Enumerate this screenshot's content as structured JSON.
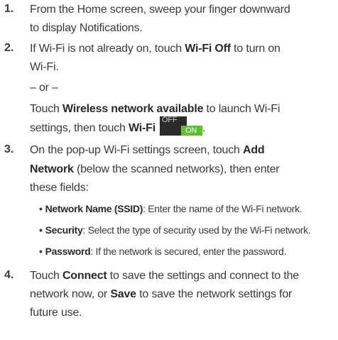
{
  "steps": [
    {
      "number": "1.",
      "text1": "From the Home screen, sweep your finger downward",
      "text2": "to display Notifications."
    },
    {
      "number": "2.",
      "pre": "If Wi-Fi is not already on, touch ",
      "bold": "Wi-Fi Off",
      "post": " to turn on",
      "cont": "Wi-Fi.",
      "or": "– or –",
      "alt_pre": "Touch ",
      "alt_bold": "Wireless network available",
      "alt_post": " to launch Wi-Fi",
      "alt2_pre": "settings, then touch ",
      "alt2_bold": "Wi-Fi",
      "alt2_post": ".",
      "toggle": {
        "off": "OFF",
        "on": "ON",
        "on_color": "#5cc22b"
      }
    },
    {
      "number": "3.",
      "pre": "On the pop-up Wi-Fi settings screen, touch ",
      "bold": "Add",
      "line2_bold": "Network",
      "line2_post": " (below the scanned networks), then enter",
      "line3": "these fields:",
      "fields": [
        {
          "name": "Network Name (SSID)",
          "desc": ": Enter the name of the Wi-Fi network."
        },
        {
          "name": "Security",
          "desc": ": Select the type of security used by the Wi-Fi network."
        },
        {
          "name": "Password",
          "desc": ": If the network is secured, enter the password."
        }
      ]
    },
    {
      "number": "4.",
      "pre": "Touch ",
      "bold": "Connect",
      "post": " to save the settings and connect to the",
      "line2_pre": "network now, or ",
      "line2_bold": "Save",
      "line2_post": " to save the network settings for",
      "line3": "future use."
    }
  ]
}
